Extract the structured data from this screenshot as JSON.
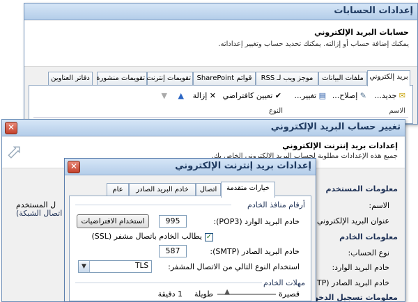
{
  "windows": {
    "accounts": {
      "title": "إعدادات الحسابات",
      "header_title": "حسابات البريد الإلكتروني",
      "header_desc": "يمكنك إضافة حساب أو إزالته. يمكنك تحديد حساب وتغيير إعداداته.",
      "tabs": [
        {
          "label": "بريد إلكتروني"
        },
        {
          "label": "ملفات البيانات"
        },
        {
          "label": "موجز ويب لـ RSS"
        },
        {
          "label": "قوائم SharePoint"
        },
        {
          "label": "تقويمات إنترنت"
        },
        {
          "label": "تقويمات منشورة"
        },
        {
          "label": "دفاتر العناوين"
        }
      ],
      "toolbar": {
        "new": "جديد...",
        "repair": "إصلاح...",
        "change": "تغيير...",
        "set_default": "تعيين كافتراضي",
        "remove": "إزالة"
      },
      "list_headers": {
        "name": "الاسم",
        "type": "النوع"
      }
    },
    "change_account": {
      "title": "تغيير حساب البريد الإلكتروني",
      "header_title": "إعدادات بريد إنترنت الإلكتروني",
      "header_desc": "جميع هذه الإعدادات مطلوبة لحساب البريد الإلكتروني الخاص بك.",
      "section_user": "معلومات المستخدم",
      "name_label": "الاسم:",
      "email_label": "عنوان البريد الإلكتروني:",
      "section_server": "معلومات الخادم",
      "account_type_label": "نوع الحساب:",
      "incoming_label": "خادم البريد الوارد:",
      "outgoing_label": "خادم البريد الصادر (SMTP):",
      "section_logon": "معلومات تسجيل الدخول",
      "left_note_1": "ل المستخدم",
      "left_note_2": "اتصال الشبكة)"
    },
    "internet_settings": {
      "title": "إعدادات بريد إنترنت الإلكتروني",
      "tabs": [
        {
          "label": "عام"
        },
        {
          "label": "خادم البريد الصادر"
        },
        {
          "label": "اتصال"
        },
        {
          "label": "خيارات متقدمة"
        }
      ],
      "ports_group": "أرقام منافذ الخادم",
      "incoming_port_label": "خادم البريد الوارد (POP3):",
      "incoming_port": "995",
      "use_defaults_button": "استخدام الافتراضيات",
      "ssl_checkbox_label": "يطالب الخادم باتصال مشفر (SSL)",
      "outgoing_port_label": "خادم البريد الصادر (SMTP):",
      "outgoing_port": "587",
      "encryption_label": "استخدام النوع التالي من الاتصال المشفر:",
      "encryption_value": "TLS",
      "timeouts_group": "مهلات الخادم",
      "timeout_short": "قصيرة",
      "timeout_long": "طويلة",
      "timeout_value": "1 دقيقة"
    }
  }
}
